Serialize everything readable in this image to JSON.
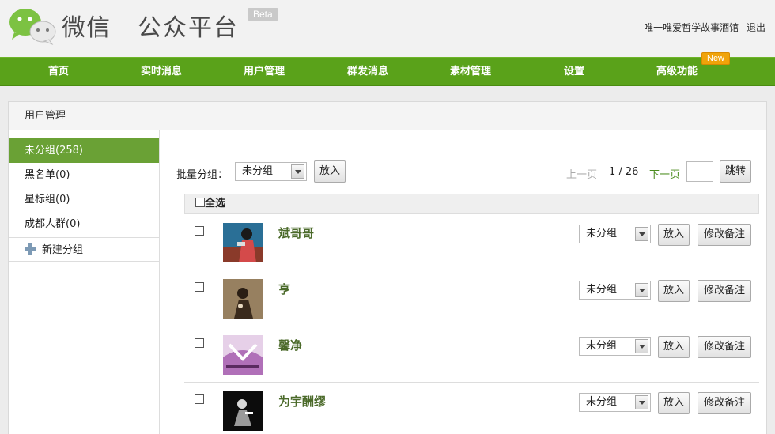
{
  "header": {
    "brand_wechat": "微信",
    "brand_platform": "公众平台",
    "beta": "Beta",
    "account_name": "唯一唯爱哲学故事酒馆",
    "logout": "退出"
  },
  "nav": {
    "items": [
      {
        "label": "首页"
      },
      {
        "label": "实时消息"
      },
      {
        "label": "用户管理"
      },
      {
        "label": "群发消息"
      },
      {
        "label": "素材管理"
      },
      {
        "label": "设置"
      },
      {
        "label": "高级功能"
      }
    ],
    "new_badge": "New"
  },
  "panel": {
    "title": "用户管理"
  },
  "sidebar": {
    "groups": [
      {
        "label": "未分组(258)",
        "active": true
      },
      {
        "label": "黑名单(0)"
      },
      {
        "label": "星标组(0)"
      },
      {
        "label": "成都人群(0)"
      }
    ],
    "add_group": "新建分组"
  },
  "toolbar": {
    "batch_label": "批量分组：",
    "batch_select": "未分组",
    "put_button": "放入",
    "prev": "上一页",
    "page": "1 / 26",
    "next": "下一页",
    "jump": "跳转"
  },
  "select_all": "全选",
  "users": [
    {
      "name": "斌哥哥",
      "group": "未分组",
      "put": "放入",
      "note": "修改备注"
    },
    {
      "name": "亨",
      "group": "未分组",
      "put": "放入",
      "note": "修改备注"
    },
    {
      "name": "馨净",
      "group": "未分组",
      "put": "放入",
      "note": "修改备注"
    },
    {
      "name": "为宇酬缪",
      "group": "未分组",
      "put": "放入",
      "note": "修改备注"
    }
  ],
  "colors": {
    "nav_green": "#5aa21a",
    "active_group": "#6aa135",
    "username": "#4b6a2a",
    "new_badge": "#f0a30a"
  }
}
